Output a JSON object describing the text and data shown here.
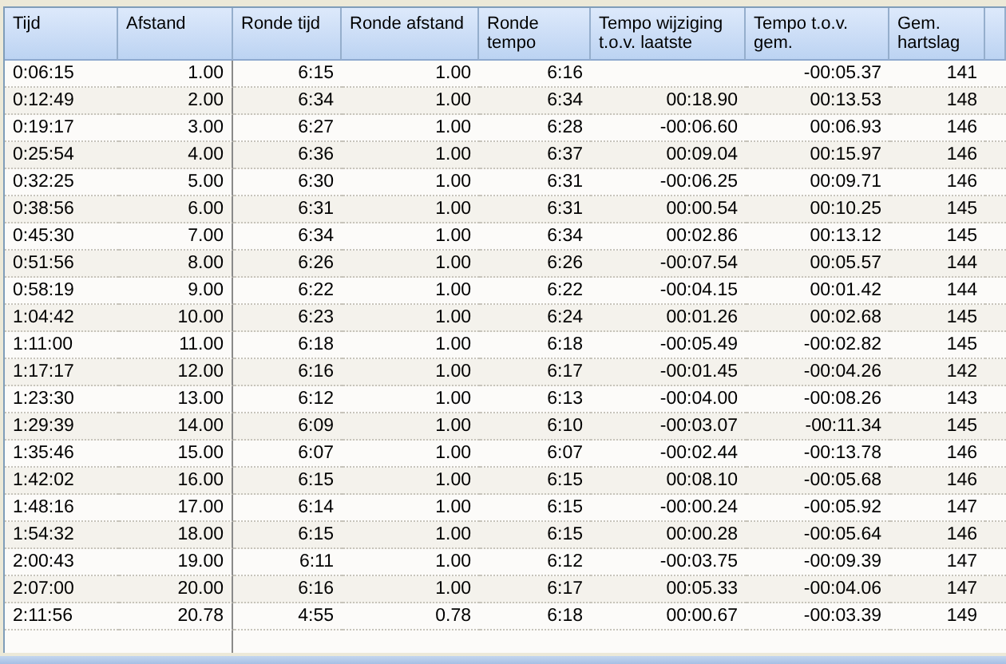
{
  "table": {
    "columns": [
      "Tijd",
      "Afstand",
      "Ronde tijd",
      "Ronde afstand",
      "Ronde tempo",
      "Tempo wijziging t.o.v. laatste",
      "Tempo t.o.v. gem.",
      "Gem. hartslag"
    ],
    "rows": [
      [
        "0:06:15",
        "1.00",
        "6:15",
        "1.00",
        "6:16",
        null,
        "-00:05.37",
        "141"
      ],
      [
        "0:12:49",
        "2.00",
        "6:34",
        "1.00",
        "6:34",
        "00:18.90",
        "00:13.53",
        "148"
      ],
      [
        "0:19:17",
        "3.00",
        "6:27",
        "1.00",
        "6:28",
        "-00:06.60",
        "00:06.93",
        "146"
      ],
      [
        "0:25:54",
        "4.00",
        "6:36",
        "1.00",
        "6:37",
        "00:09.04",
        "00:15.97",
        "146"
      ],
      [
        "0:32:25",
        "5.00",
        "6:30",
        "1.00",
        "6:31",
        "-00:06.25",
        "00:09.71",
        "146"
      ],
      [
        "0:38:56",
        "6.00",
        "6:31",
        "1.00",
        "6:31",
        "00:00.54",
        "00:10.25",
        "145"
      ],
      [
        "0:45:30",
        "7.00",
        "6:34",
        "1.00",
        "6:34",
        "00:02.86",
        "00:13.12",
        "145"
      ],
      [
        "0:51:56",
        "8.00",
        "6:26",
        "1.00",
        "6:26",
        "-00:07.54",
        "00:05.57",
        "144"
      ],
      [
        "0:58:19",
        "9.00",
        "6:22",
        "1.00",
        "6:22",
        "-00:04.15",
        "00:01.42",
        "144"
      ],
      [
        "1:04:42",
        "10.00",
        "6:23",
        "1.00",
        "6:24",
        "00:01.26",
        "00:02.68",
        "145"
      ],
      [
        "1:11:00",
        "11.00",
        "6:18",
        "1.00",
        "6:18",
        "-00:05.49",
        "-00:02.82",
        "145"
      ],
      [
        "1:17:17",
        "12.00",
        "6:16",
        "1.00",
        "6:17",
        "-00:01.45",
        "-00:04.26",
        "142"
      ],
      [
        "1:23:30",
        "13.00",
        "6:12",
        "1.00",
        "6:13",
        "-00:04.00",
        "-00:08.26",
        "143"
      ],
      [
        "1:29:39",
        "14.00",
        "6:09",
        "1.00",
        "6:10",
        "-00:03.07",
        "-00:11.34",
        "145"
      ],
      [
        "1:35:46",
        "15.00",
        "6:07",
        "1.00",
        "6:07",
        "-00:02.44",
        "-00:13.78",
        "146"
      ],
      [
        "1:42:02",
        "16.00",
        "6:15",
        "1.00",
        "6:15",
        "00:08.10",
        "-00:05.68",
        "146"
      ],
      [
        "1:48:16",
        "17.00",
        "6:14",
        "1.00",
        "6:15",
        "-00:00.24",
        "-00:05.92",
        "147"
      ],
      [
        "1:54:32",
        "18.00",
        "6:15",
        "1.00",
        "6:15",
        "00:00.28",
        "-00:05.64",
        "146"
      ],
      [
        "2:00:43",
        "19.00",
        "6:11",
        "1.00",
        "6:12",
        "-00:03.75",
        "-00:09.39",
        "147"
      ],
      [
        "2:07:00",
        "20.00",
        "6:16",
        "1.00",
        "6:17",
        "00:05.33",
        "-00:04.06",
        "147"
      ],
      [
        "2:11:56",
        "20.78",
        "4:55",
        "0.78",
        "6:18",
        "00:00.67",
        "-00:03.39",
        "149"
      ]
    ]
  }
}
